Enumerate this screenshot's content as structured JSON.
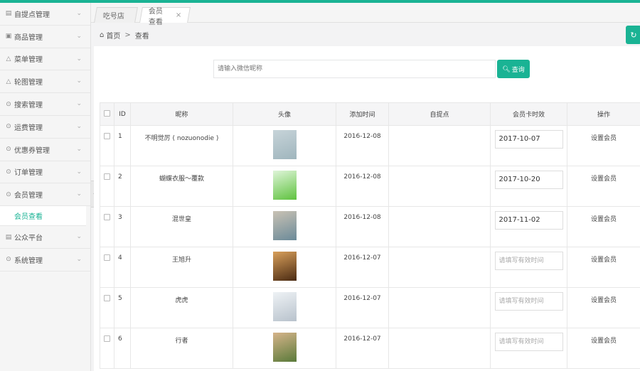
{
  "sidebar": {
    "items": [
      {
        "icon": "list-icon",
        "glyph": "▤",
        "label": "自提点管理"
      },
      {
        "icon": "image-icon",
        "glyph": "▣",
        "label": "商品管理"
      },
      {
        "icon": "bag-icon",
        "glyph": "△",
        "label": "菜单管理"
      },
      {
        "icon": "bag-icon",
        "glyph": "△",
        "label": "轮图管理"
      },
      {
        "icon": "circle-icon",
        "glyph": "⊙",
        "label": "搜索管理"
      },
      {
        "icon": "circle-icon",
        "glyph": "⊙",
        "label": "运费管理"
      },
      {
        "icon": "circle-icon",
        "glyph": "⊙",
        "label": "优惠券管理"
      },
      {
        "icon": "circle-icon",
        "glyph": "⊙",
        "label": "订单管理"
      },
      {
        "icon": "circle-icon",
        "glyph": "⊙",
        "label": "会员管理"
      }
    ],
    "sub_item": "会员查看",
    "items_after": [
      {
        "icon": "list-icon",
        "glyph": "▤",
        "label": "公众平台"
      },
      {
        "icon": "circle-icon",
        "glyph": "⊙",
        "label": "系统管理"
      }
    ]
  },
  "tabs": [
    {
      "label": "吃号店"
    },
    {
      "label": "会员查看",
      "close": "×"
    }
  ],
  "breadcrumb": {
    "home": "首页",
    "separator": ">",
    "current": "查看"
  },
  "search": {
    "placeholder": "请输入微信昵称",
    "button_label": "查询"
  },
  "table": {
    "headers": [
      "ID",
      "昵称",
      "头像",
      "添加时间",
      "自提点",
      "会员卡时效",
      "操作"
    ],
    "rows": [
      {
        "id": "1",
        "nickname": "不明觉厉 ( nozuonodie )",
        "added": "2016-12-08",
        "pickup": "",
        "expiry": "2017-10-07",
        "action": "设置会员",
        "avatar": [
          "#c7d4d9",
          "#9fb5bd"
        ]
      },
      {
        "id": "2",
        "nickname": "蝴蝶衣服～覆款",
        "added": "2016-12-08",
        "pickup": "",
        "expiry": "2017-10-20",
        "action": "设置会员",
        "avatar": [
          "#dff5d9",
          "#5fc23f"
        ]
      },
      {
        "id": "3",
        "nickname": "混世皇",
        "added": "2016-12-08",
        "pickup": "",
        "expiry": "2017-11-02",
        "action": "设置会员",
        "avatar": [
          "#c9c2b4",
          "#6b8a99"
        ]
      },
      {
        "id": "4",
        "nickname": "王旭升",
        "added": "2016-12-07",
        "pickup": "",
        "expiry": "",
        "action": "设置会员",
        "avatar": [
          "#d9a05b",
          "#4a2a12"
        ]
      },
      {
        "id": "5",
        "nickname": "虎虎",
        "added": "2016-12-07",
        "pickup": "",
        "expiry": "",
        "action": "设置会员",
        "avatar": [
          "#eef2f5",
          "#b8c2cc"
        ]
      },
      {
        "id": "6",
        "nickname": "行者",
        "added": "2016-12-07",
        "pickup": "",
        "expiry": "",
        "action": "设置会员",
        "avatar": [
          "#d6b48a",
          "#5a7a3a"
        ]
      }
    ],
    "expiry_placeholder": "请填写有效时间"
  },
  "colors": {
    "accent": "#1ab394"
  }
}
